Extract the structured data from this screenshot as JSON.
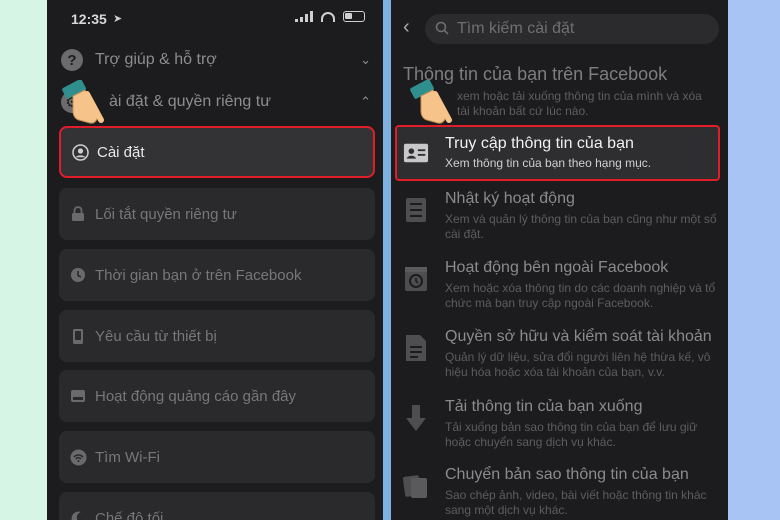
{
  "left_phone": {
    "status": {
      "time": "12:35"
    },
    "sections": [
      {
        "label": "Trợ giúp & hỗ trợ",
        "icon": "question-icon",
        "chevron": "chevron-down-icon"
      },
      {
        "label": "ài đặt & quyền riêng tư",
        "icon": "gear-icon",
        "chevron": "chevron-up-icon"
      }
    ],
    "menu_items": [
      {
        "label": "Cài đặt",
        "icon": "user-circle-icon",
        "active": true
      },
      {
        "label": "Lối tắt quyền riêng tư",
        "icon": "lock-icon"
      },
      {
        "label": "Thời gian bạn ở trên Facebook",
        "icon": "clock-icon"
      },
      {
        "label": "Yêu cầu từ thiết bị",
        "icon": "phone-icon"
      },
      {
        "label": "Hoạt động quảng cáo gần đây",
        "icon": "ad-icon"
      },
      {
        "label": "Tìm Wi-Fi",
        "icon": "wifi-icon"
      },
      {
        "label": "Chế độ tối",
        "icon": "moon-icon"
      }
    ]
  },
  "right_phone": {
    "search": {
      "placeholder": "Tìm kiếm cài đặt"
    },
    "section_title": "Thông tin của bạn trên Facebook",
    "section_subtitle": "xem hoặc tải xuống thông tin của mình và xóa tài khoản bất cứ lúc nào.",
    "items": [
      {
        "title": "Truy cập thông tin của bạn",
        "desc": "Xem thông tin của bạn theo hạng mục.",
        "icon": "id-card-icon",
        "active": true
      },
      {
        "title": "Nhật ký hoạt động",
        "desc": "Xem và quản lý thông tin của bạn cũng như một số cài đặt.",
        "icon": "list-icon"
      },
      {
        "title": "Hoạt động bên ngoài Facebook",
        "desc": "Xem hoặc xóa thông tin do các doanh nghiệp và tổ chức mà bạn truy cập ngoài Facebook.",
        "icon": "history-icon"
      },
      {
        "title": "Quyền sở hữu và kiểm soát tài khoản",
        "desc": "Quản lý dữ liệu, sửa đổi người liên hệ thừa kế, vô hiệu hóa hoặc xóa tài khoản của bạn, v.v.",
        "icon": "document-icon"
      },
      {
        "title": "Tải thông tin của bạn xuống",
        "desc": "Tải xuống bản sao thông tin của bạn để lưu giữ hoặc chuyển sang dịch vụ khác.",
        "icon": "download-icon"
      },
      {
        "title": "Chuyển bản sao thông tin của bạn",
        "desc": "Sao chép ảnh, video, bài viết hoặc thông tin khác sang một dịch vụ khác.",
        "icon": "transfer-icon"
      }
    ]
  },
  "colors": {
    "highlight": "#e11d2a",
    "background": "#1c1c1e",
    "card": "#2a2a2c"
  }
}
